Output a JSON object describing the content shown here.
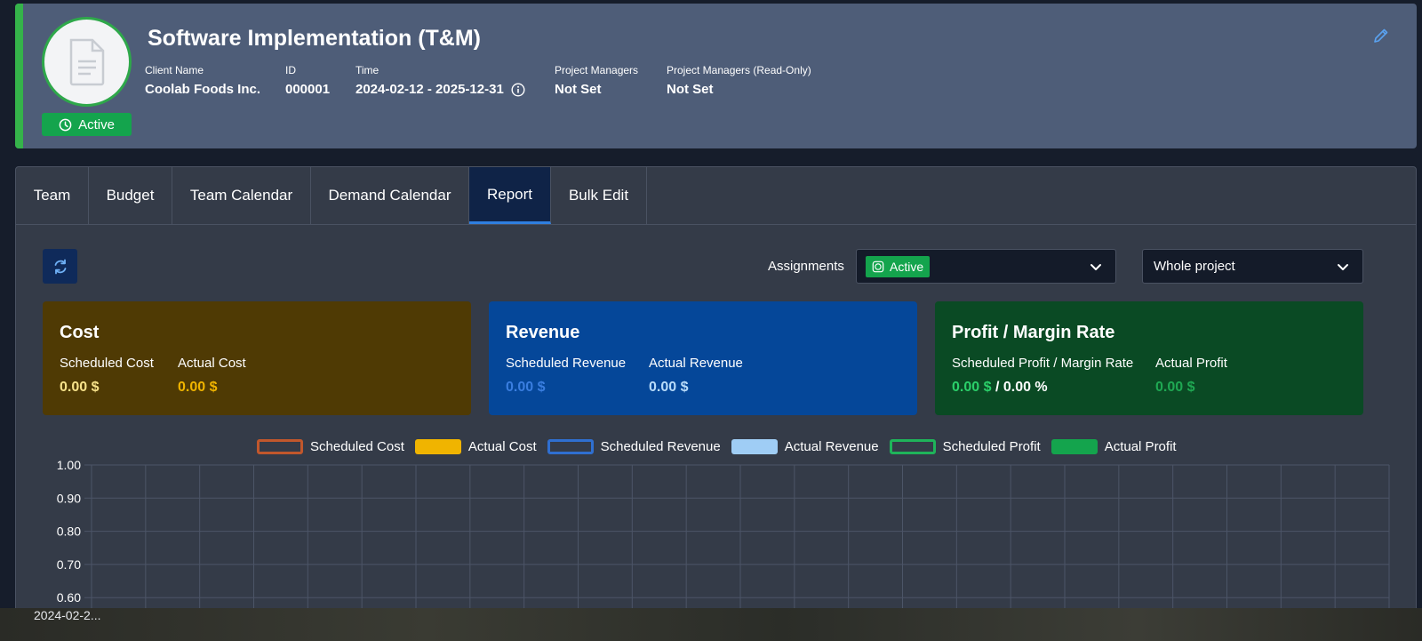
{
  "project": {
    "title": "Software Implementation (T&M)",
    "status": "Active",
    "meta": [
      {
        "label": "Client Name",
        "value": "Coolab Foods Inc."
      },
      {
        "label": "ID",
        "value": "000001"
      },
      {
        "label": "Time",
        "value": "2024-02-12 - 2025-12-31"
      },
      {
        "label": "Project Managers",
        "value": "Not Set"
      },
      {
        "label": "Project Managers (Read-Only)",
        "value": "Not Set"
      }
    ]
  },
  "tabs": [
    {
      "label": "Team"
    },
    {
      "label": "Budget"
    },
    {
      "label": "Team Calendar"
    },
    {
      "label": "Demand Calendar"
    },
    {
      "label": "Report",
      "active": true
    },
    {
      "label": "Bulk Edit"
    }
  ],
  "filters": {
    "assignments_label": "Assignments",
    "assignments_chip": "Active",
    "period_select": "Whole project"
  },
  "cards": {
    "cost": {
      "title": "Cost",
      "scheduled_label": "Scheduled Cost",
      "scheduled_value": "0.00 $",
      "actual_label": "Actual Cost",
      "actual_value": "0.00 $"
    },
    "revenue": {
      "title": "Revenue",
      "scheduled_label": "Scheduled Revenue",
      "scheduled_value": "0.00 $",
      "actual_label": "Actual Revenue",
      "actual_value": "0.00 $"
    },
    "profit": {
      "title": "Profit / Margin Rate",
      "scheduled_label": "Scheduled Profit / Margin Rate",
      "scheduled_value": "0.00 $",
      "scheduled_separator": "/",
      "scheduled_rate": "0.00 %",
      "actual_label": "Actual Profit",
      "actual_value": "0.00 $"
    }
  },
  "colors": {
    "active_green": "#14a44d",
    "cost_bg": "#4f3a04",
    "revenue_bg": "#054799",
    "profit_bg": "#0a4a24",
    "scheduled_cost": "#c1572c",
    "actual_cost": "#f0b400",
    "scheduled_revenue": "#2f6fd0",
    "actual_revenue": "#9fcdf5",
    "scheduled_profit": "#1fb35a",
    "actual_profit": "#14a44d"
  },
  "chart_data": {
    "type": "line",
    "legend_position": "top",
    "grid": true,
    "series": [
      {
        "name": "Scheduled Cost",
        "style": "outline",
        "color": "#c1572c",
        "values": []
      },
      {
        "name": "Actual Cost",
        "style": "filled",
        "color": "#f0b400",
        "values": []
      },
      {
        "name": "Scheduled Revenue",
        "style": "outline",
        "color": "#2f6fd0",
        "values": []
      },
      {
        "name": "Actual Revenue",
        "style": "filled",
        "color": "#9fcdf5",
        "values": []
      },
      {
        "name": "Scheduled Profit",
        "style": "outline",
        "color": "#1fb35a",
        "values": []
      },
      {
        "name": "Actual Profit",
        "style": "filled",
        "color": "#14a44d",
        "values": []
      }
    ],
    "y_ticks": [
      "1.00",
      "0.90",
      "0.80",
      "0.70",
      "0.60"
    ],
    "y_values": [
      1.0,
      0.9,
      0.8,
      0.7,
      0.6
    ],
    "ylim": [
      0.6,
      1.0
    ],
    "x_tick_first": "2024-02-2..."
  }
}
